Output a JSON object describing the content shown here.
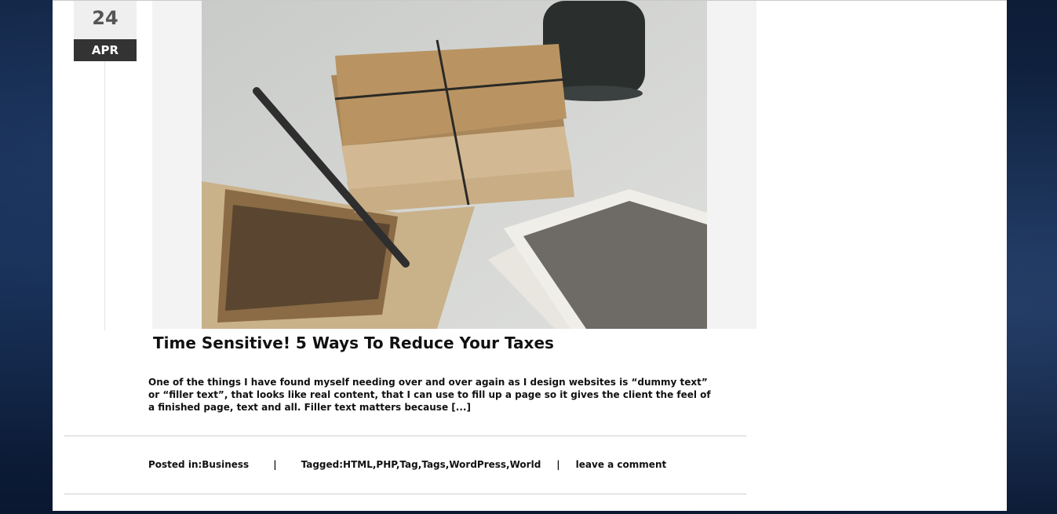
{
  "post": {
    "date": {
      "day": "24",
      "month": "APR"
    },
    "title": "Time Sensitive! 5 Ways To Reduce Your Taxes",
    "excerpt": "One of the things I have found myself needing over and over again as I design websites is “dummy text” or “filler text”, that looks like real content, that I can use to fill up a page so it gives the client the feel of a finished page, text and all. Filler text matters because",
    "read_more": "[...]",
    "meta": {
      "posted_in_label": "Posted in:",
      "category": "Business",
      "separator": "|",
      "tagged_label": "Tagged:",
      "tags": [
        "HTML",
        "PHP",
        "Tag",
        "Tags",
        "WordPress",
        "World"
      ],
      "comment_link": "leave a comment"
    }
  },
  "colors": {
    "date_day_bg": "#efefef",
    "date_month_bg": "#333333",
    "text": "#111111",
    "divider": "#cfcfcf"
  }
}
